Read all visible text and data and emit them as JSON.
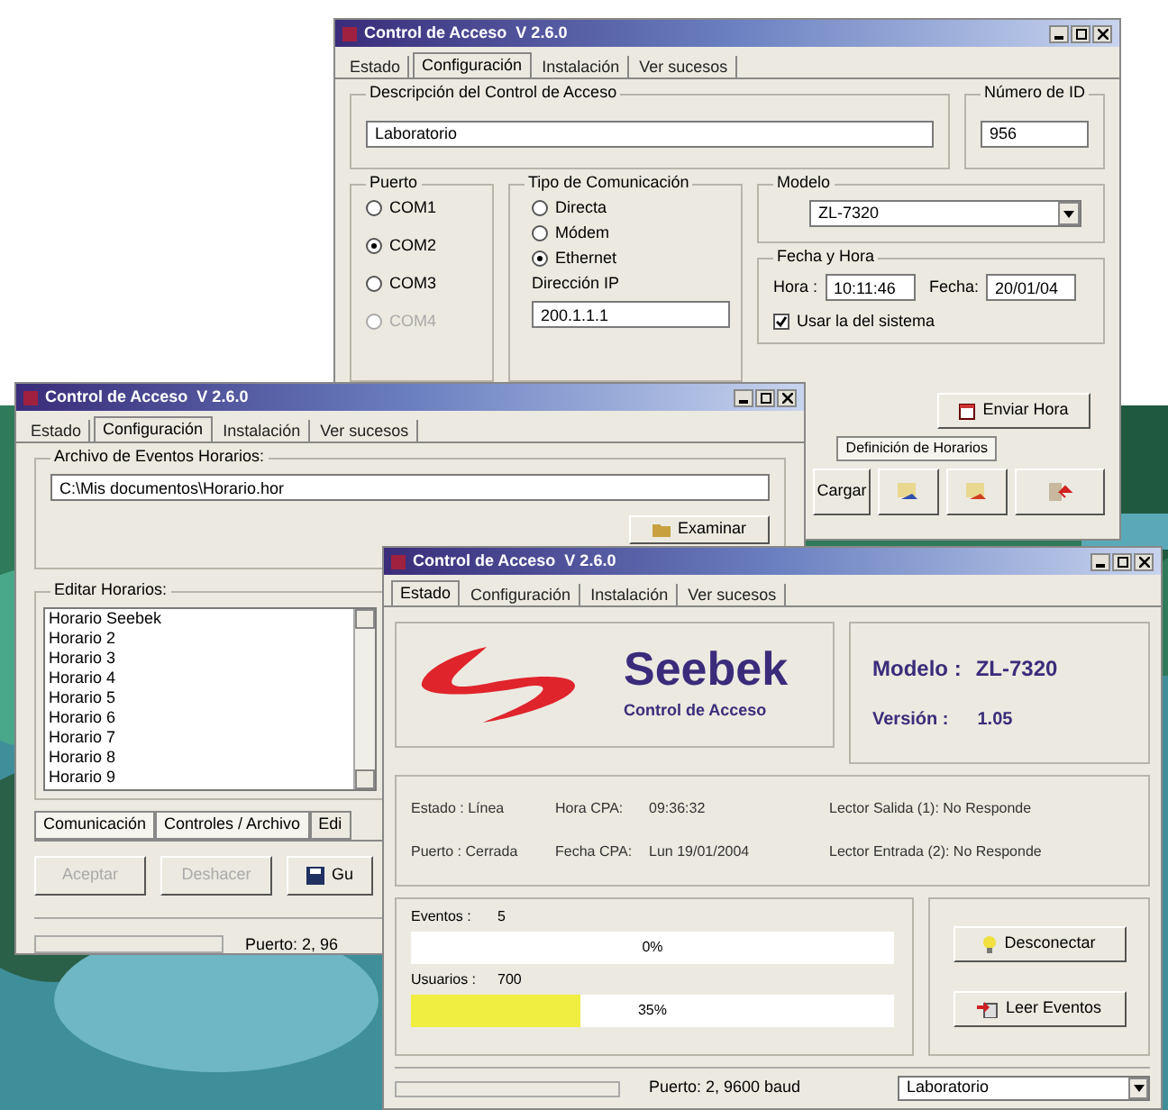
{
  "config_window": {
    "title": "Control de Acceso  V 2.6.0",
    "tabs": [
      {
        "label": "Estado",
        "selected": false
      },
      {
        "label": "Configuración",
        "selected": true
      },
      {
        "label": "Instalación",
        "selected": false
      },
      {
        "label": "Ver sucesos",
        "selected": false
      }
    ],
    "description": {
      "legend": "Descripción del Control de Acceso",
      "value": "Laboratorio"
    },
    "id_number": {
      "legend": "Número de ID",
      "value": "956"
    },
    "port": {
      "legend": "Puerto",
      "options": [
        {
          "label": "COM1",
          "selected": false,
          "disabled": false
        },
        {
          "label": "COM2",
          "selected": true,
          "disabled": false
        },
        {
          "label": "COM3",
          "selected": false,
          "disabled": false
        },
        {
          "label": "COM4",
          "selected": false,
          "disabled": true
        }
      ]
    },
    "comm_type": {
      "legend": "Tipo de Comunicación",
      "options": [
        {
          "label": "Directa",
          "selected": false
        },
        {
          "label": "Módem",
          "selected": false
        },
        {
          "label": "Ethernet",
          "selected": true
        }
      ],
      "ip_label": "Dirección IP",
      "ip_value": "200.1.1.1"
    },
    "model": {
      "legend": "Modelo",
      "value": "ZL-7320"
    },
    "datetime": {
      "legend": "Fecha y Hora",
      "time_label": "Hora :",
      "time_value": "10:11:46",
      "date_label": "Fecha:",
      "date_value": "20/01/04",
      "use_system": {
        "label": "Usar la del sistema",
        "checked": true
      }
    },
    "send_time_button": "Enviar Hora",
    "bottom_tabs": [
      {
        "label": "Definición de Horarios",
        "selected": false
      }
    ],
    "load_button": "Cargar"
  },
  "schedules_window": {
    "title": "Control de Acceso  V 2.6.0",
    "tabs": [
      {
        "label": "Estado",
        "selected": false
      },
      {
        "label": "Configuración",
        "selected": true
      },
      {
        "label": "Instalación",
        "selected": false
      },
      {
        "label": "Ver sucesos",
        "selected": false
      }
    ],
    "file": {
      "legend": "Archivo de Eventos Horarios:",
      "value": "C:\\Mis documentos\\Horario.hor",
      "browse_button": "Examinar"
    },
    "edit": {
      "legend": "Editar Horarios:",
      "items": [
        "Horario Seebek",
        "Horario 2",
        "Horario 3",
        "Horario 4",
        "Horario 5",
        "Horario 6",
        "Horario 7",
        "Horario 8",
        "Horario 9"
      ]
    },
    "bottom_tabs": [
      {
        "label": "Comunicación",
        "selected": false
      },
      {
        "label": "Controles / Archivo",
        "selected": false
      },
      {
        "label": "Edi",
        "selected": true
      }
    ],
    "buttons": [
      {
        "label": "Aceptar",
        "disabled": true
      },
      {
        "label": "Deshacer",
        "disabled": true
      },
      {
        "label": "Gu",
        "disabled": false
      }
    ],
    "status": "Puerto: 2, 96"
  },
  "status_window": {
    "title": "Control de Acceso  V 2.6.0",
    "tabs": [
      {
        "label": "Estado",
        "selected": true
      },
      {
        "label": "Configuración",
        "selected": false
      },
      {
        "label": "Instalación",
        "selected": false
      },
      {
        "label": "Ver sucesos",
        "selected": false
      }
    ],
    "logo": {
      "name": "Seebek",
      "tagline": "Control de Acceso"
    },
    "model": {
      "label": "Modelo :",
      "value": "ZL-7320"
    },
    "version": {
      "label": "Versión :",
      "value": "1.05"
    },
    "info": [
      [
        "Estado : Línea",
        "Hora CPA:",
        "09:36:32",
        "Lector Salida (1): No Responde"
      ],
      [
        "Puerto : Cerrada",
        "Fecha CPA:",
        "Lun 19/01/2004",
        "Lector Entrada (2): No Responde"
      ]
    ],
    "meters": [
      {
        "label": "Eventos :",
        "count": "5",
        "level": 0,
        "reading": "0%"
      },
      {
        "label": "Usuarios :",
        "count": "700",
        "level": 0.35,
        "reading": "35%"
      }
    ],
    "disconnect_button": "Desconectar",
    "read_button": "Leer Eventos",
    "status": "Puerto: 2, 9600 baud",
    "site": "Laboratorio"
  }
}
